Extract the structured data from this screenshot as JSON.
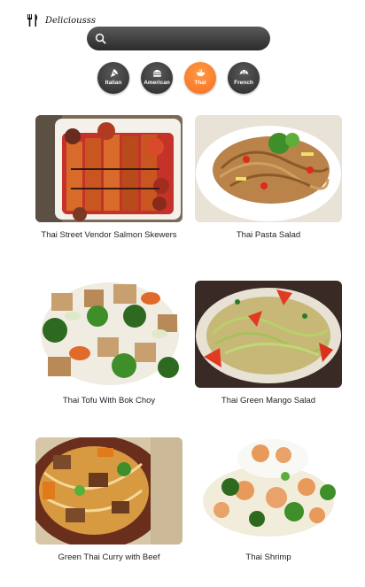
{
  "app": {
    "name": "Deliciousss"
  },
  "search": {
    "placeholder": ""
  },
  "categories": [
    {
      "label": "Italian",
      "icon": "pizza-icon",
      "active": false
    },
    {
      "label": "American",
      "icon": "burger-icon",
      "active": false
    },
    {
      "label": "Thai",
      "icon": "bowl-icon",
      "active": true
    },
    {
      "label": "French",
      "icon": "croissant-icon",
      "active": false
    }
  ],
  "colors": {
    "accent": "#f86e1b",
    "dark": "#2b2b2b"
  },
  "recipes": [
    {
      "title": "Thai Street Vendor Salmon Skewers"
    },
    {
      "title": "Thai Pasta Salad"
    },
    {
      "title": "Thai Tofu With Bok Choy"
    },
    {
      "title": "Thai Green Mango Salad"
    },
    {
      "title": "Green Thai Curry with Beef"
    },
    {
      "title": "Thai Shrimp"
    }
  ]
}
